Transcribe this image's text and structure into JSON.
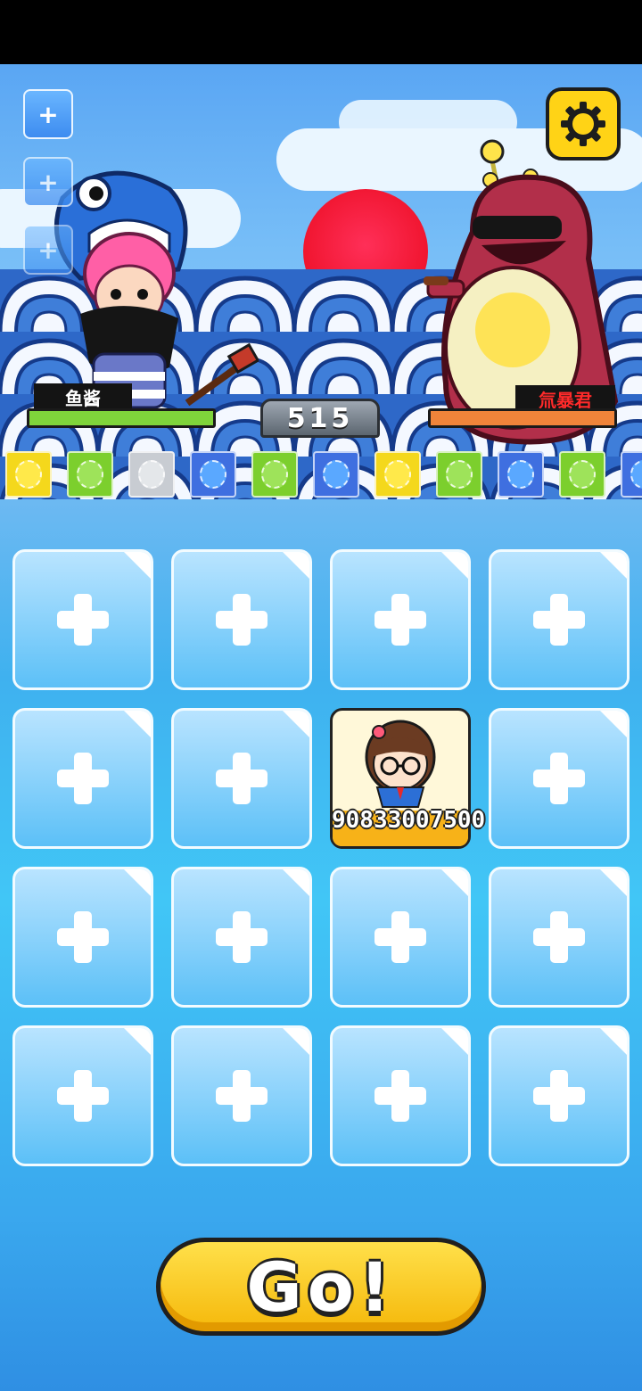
{
  "hero": {
    "name": "鱼酱",
    "hp_color": "#7fd43b"
  },
  "boss": {
    "name": "氚暴君",
    "name_color": "#ff2a2a",
    "hp_color": "#f0843a"
  },
  "round": {
    "value": "515"
  },
  "side_buttons": [
    {
      "icon": "plus-icon"
    },
    {
      "icon": "plus-icon"
    },
    {
      "icon": "plus-icon"
    }
  ],
  "settings": {
    "icon": "gear-icon"
  },
  "queue": [
    {
      "color": "#f4d81c",
      "ball": "#ffe94a"
    },
    {
      "color": "#7ccf2d",
      "ball": "#9ee35a"
    },
    {
      "color": "#c8ccd2",
      "ball": "#e4e7ea"
    },
    {
      "color": "#3f6fe0",
      "ball": "#5aa8ff"
    },
    {
      "color": "#7ccf2d",
      "ball": "#9ee35a"
    },
    {
      "color": "#3f6fe0",
      "ball": "#5aa8ff"
    },
    {
      "color": "#f4d81c",
      "ball": "#ffe94a"
    },
    {
      "color": "#7ccf2d",
      "ball": "#9ee35a"
    },
    {
      "color": "#3f6fe0",
      "ball": "#5aa8ff"
    },
    {
      "color": "#7ccf2d",
      "ball": "#9ee35a"
    },
    {
      "color": "#3f6fe0",
      "ball": "#5aa8ff"
    }
  ],
  "grid": {
    "rows": 4,
    "cols": 4,
    "filled_index": 6
  },
  "card": {
    "value": "9083300750​0"
  },
  "go_button": {
    "label": "Go!"
  }
}
